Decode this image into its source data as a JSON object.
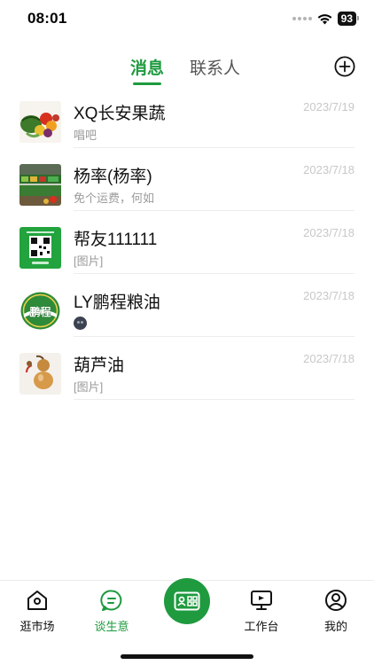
{
  "status_bar": {
    "time": "08:01",
    "battery": "93"
  },
  "tabs": {
    "messages": "消息",
    "contacts": "联系人"
  },
  "messages": [
    {
      "name": "XQ长安果蔬",
      "preview": "唱吧",
      "date": "2023/7/19",
      "avatar": "fruit-vegetable-photo"
    },
    {
      "name": "杨率(杨率)",
      "preview": "免个运费，何如",
      "date": "2023/7/18",
      "avatar": "market-shelf-photo"
    },
    {
      "name": "帮友111111",
      "preview": "[图片]",
      "date": "2023/7/18",
      "avatar": "green-qr-code-card"
    },
    {
      "name": "LY鹏程粮油",
      "preview": "",
      "date": "2023/7/18",
      "avatar": "pengcheng-logo",
      "logo_text": "鹏程"
    },
    {
      "name": "葫芦油",
      "preview": "[图片]",
      "date": "2023/7/18",
      "avatar": "gourd-figurine-photo"
    }
  ],
  "bottom_nav": {
    "market": "逛市场",
    "business": "谈生意",
    "workbench": "工作台",
    "mine": "我的"
  },
  "colors": {
    "accent": "#1e9a3f",
    "date": "#c8c8c8",
    "preview": "#9a9a9a"
  }
}
